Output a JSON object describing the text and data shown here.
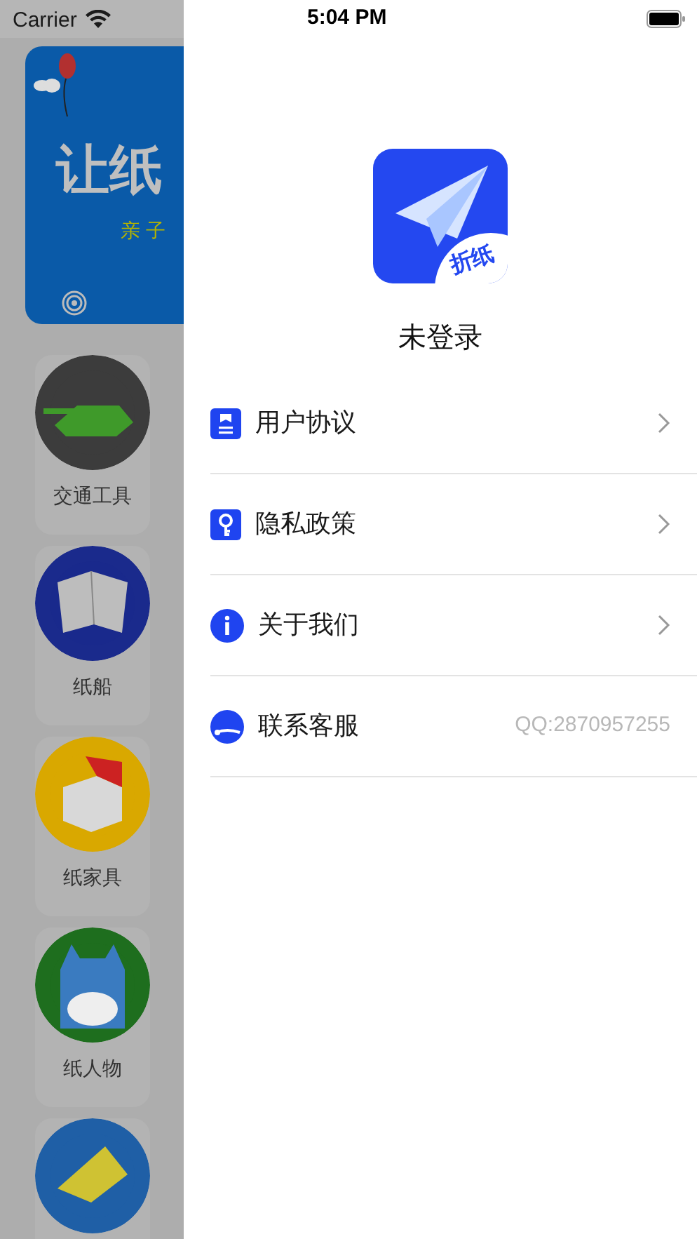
{
  "status_bar": {
    "carrier": "Carrier",
    "time": "5:04 PM"
  },
  "background": {
    "banner": {
      "title": "让纸",
      "subtitle": "亲子"
    },
    "categories": [
      {
        "label": "交通工具",
        "color": "#3c3c3c"
      },
      {
        "label": "纸船",
        "color": "#1a2a8c"
      },
      {
        "label": "纸家具",
        "color": "#d9a800"
      },
      {
        "label": "纸人物",
        "color": "#1e6e1e"
      },
      {
        "color": "#1f5fa6"
      }
    ]
  },
  "drawer": {
    "logo_text": "折纸",
    "user_name": "未登录",
    "menu": [
      {
        "kind": "document",
        "label": "用户协议",
        "chevron": true
      },
      {
        "kind": "key",
        "label": "隐私政策",
        "chevron": true
      },
      {
        "kind": "info",
        "label": "关于我们",
        "chevron": true
      },
      {
        "kind": "headset",
        "label": "联系客服",
        "chevron": false,
        "detail": "QQ:2870957255"
      }
    ]
  }
}
